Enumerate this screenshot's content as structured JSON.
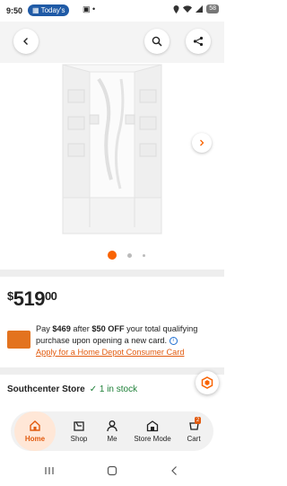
{
  "status_bar": {
    "time": "9:50",
    "pill_label": "Today's",
    "misc": "▣ •",
    "battery": "58"
  },
  "header": {
    "back_icon": "chevron-left",
    "search_icon": "search",
    "share_icon": "share"
  },
  "gallery": {
    "current_index": 0,
    "dot_count": 3,
    "accent": "#f96302"
  },
  "price": {
    "currency": "$",
    "dollars": "519",
    "cents": "00"
  },
  "promo": {
    "line_pre": "Pay ",
    "pay_amount": "$469",
    "line_mid": " after ",
    "off_amount": "$50 OFF",
    "line_post": " your total qualifying purchase upon opening a new card.",
    "apply_link": "Apply for a Home Depot Consumer Card"
  },
  "store": {
    "name": "Southcenter Store",
    "stock": "1 in stock"
  },
  "bottom_nav": {
    "items": [
      {
        "label": "Home",
        "icon": "home-icon"
      },
      {
        "label": "Shop",
        "icon": "shop-icon"
      },
      {
        "label": "Me",
        "icon": "person-icon"
      },
      {
        "label": "Store Mode",
        "icon": "store-icon"
      },
      {
        "label": "Cart",
        "icon": "cart-icon"
      }
    ],
    "cart_count": "2"
  }
}
